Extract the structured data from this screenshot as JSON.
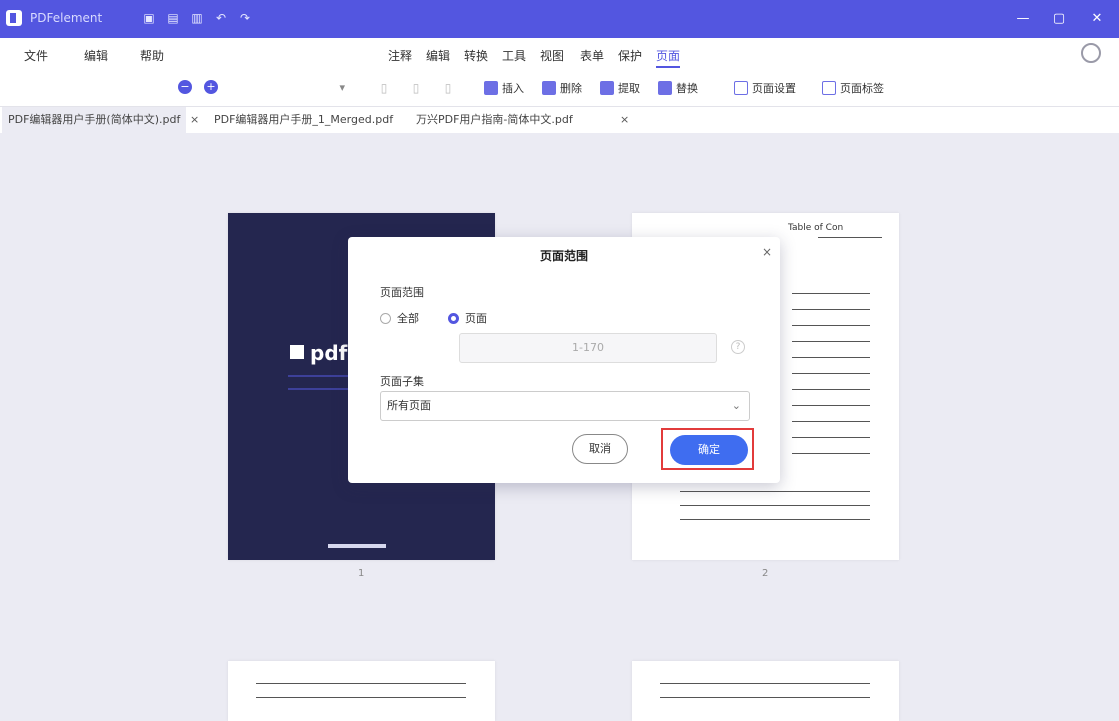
{
  "app": {
    "title": "PDFelement",
    "colors": {
      "brand": "#5356e0",
      "primary_button": "#3f6df0",
      "highlight": "#e23b3b",
      "cover": "#24264f",
      "canvas": "#ebebf3"
    },
    "quick_access_icons": [
      "save-icon",
      "print-icon",
      "open-icon",
      "undo-icon",
      "redo-icon"
    ],
    "window_controls": [
      "minimize-icon",
      "maximize-icon",
      "close-icon"
    ]
  },
  "menu": {
    "left": [
      "文件",
      "编辑",
      "帮助"
    ],
    "main": [
      "注释",
      "编辑",
      "转换",
      "工具",
      "视图",
      "表单",
      "保护",
      "页面"
    ],
    "active": "页面"
  },
  "toolbar": {
    "zoom_value": "",
    "tools": [
      "插入",
      "删除",
      "提取",
      "替换",
      "页面设置",
      "页面标签"
    ]
  },
  "tabs": [
    {
      "label": "PDF编辑器用户手册(简体中文).pdf",
      "close": "×",
      "active": true
    },
    {
      "label": "PDF编辑器用户手册_1_Merged.pdf",
      "close": "",
      "active": false
    },
    {
      "label": "万兴PDF用户指南-简体中文.pdf",
      "close": "×",
      "active": false
    }
  ],
  "document": {
    "cover_brand": "pdf",
    "toc_title": "Table of Con",
    "page_numbers": [
      "1",
      "2"
    ]
  },
  "dialog": {
    "title": "页面范围",
    "close": "×",
    "range_label": "页面范围",
    "radio_all": "全部",
    "radio_custom": "页面",
    "range_value": "1-170",
    "range_help": "?",
    "subset_label": "页面子集",
    "subset_value": "所有页面",
    "cancel": "取消",
    "ok": "确定"
  }
}
